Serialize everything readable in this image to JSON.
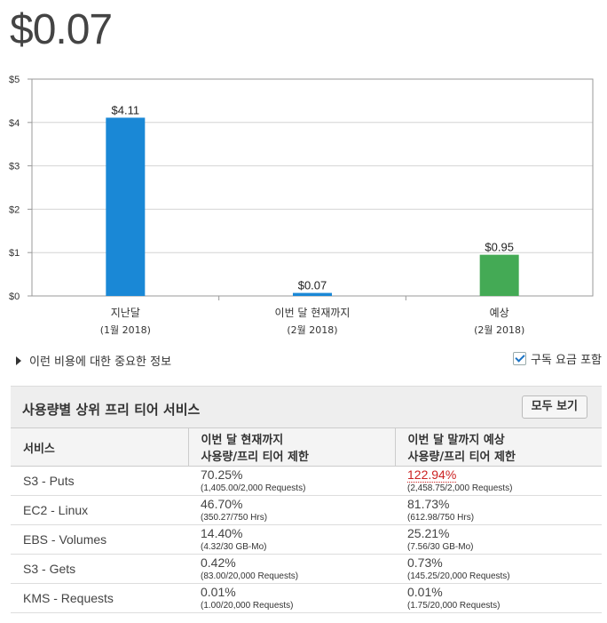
{
  "total_amount": "$0.07",
  "chart_data": {
    "type": "bar",
    "categories": [
      "지난달",
      "이번 달 현재까지",
      "예상"
    ],
    "category_sublabels": [
      "(1월 2018)",
      "(2월 2018)",
      "(2월 2018)"
    ],
    "values": [
      4.11,
      0.07,
      0.95
    ],
    "value_labels": [
      "$4.11",
      "$0.07",
      "$0.95"
    ],
    "colors": [
      "#1a88d6",
      "#1a88d6",
      "#44aa55"
    ],
    "yticks": [
      "$0",
      "$1",
      "$2",
      "$3",
      "$4",
      "$5"
    ],
    "ylim": [
      0,
      5
    ],
    "grid": true
  },
  "notice_text": "이런 비용에 대한 중요한 정보",
  "subscription_label": "구독 요금 포함",
  "subscription_checked": true,
  "panel": {
    "title": "사용량별 상위 프리 티어 서비스",
    "view_all_label": "모두 보기",
    "headers": {
      "service": "서비스",
      "mtd_line1": "이번 달 현재까지",
      "mtd_line2": "사용량/프리 티어 제한",
      "forecast_line1": "이번 달 말까지 예상",
      "forecast_line2": "사용량/프리 티어 제한"
    },
    "rows": [
      {
        "service": "S3 - Puts",
        "mtd_pct": "70.25%",
        "mtd_detail": "(1,405.00/2,000 Requests)",
        "fc_pct": "122.94%",
        "fc_detail": "(2,458.75/2,000 Requests)"
      },
      {
        "service": "EC2 - Linux",
        "mtd_pct": "46.70%",
        "mtd_detail": "(350.27/750 Hrs)",
        "fc_pct": "81.73%",
        "fc_detail": "(612.98/750 Hrs)"
      },
      {
        "service": "EBS - Volumes",
        "mtd_pct": "14.40%",
        "mtd_detail": "(4.32/30 GB-Mo)",
        "fc_pct": "25.21%",
        "fc_detail": "(7.56/30 GB-Mo)"
      },
      {
        "service": "S3 - Gets",
        "mtd_pct": "0.42%",
        "mtd_detail": "(83.00/20,000 Requests)",
        "fc_pct": "0.73%",
        "fc_detail": "(145.25/20,000 Requests)"
      },
      {
        "service": "KMS - Requests",
        "mtd_pct": "0.01%",
        "mtd_detail": "(1.00/20,000 Requests)",
        "fc_pct": "0.01%",
        "fc_detail": "(1.75/20,000 Requests)"
      }
    ]
  }
}
